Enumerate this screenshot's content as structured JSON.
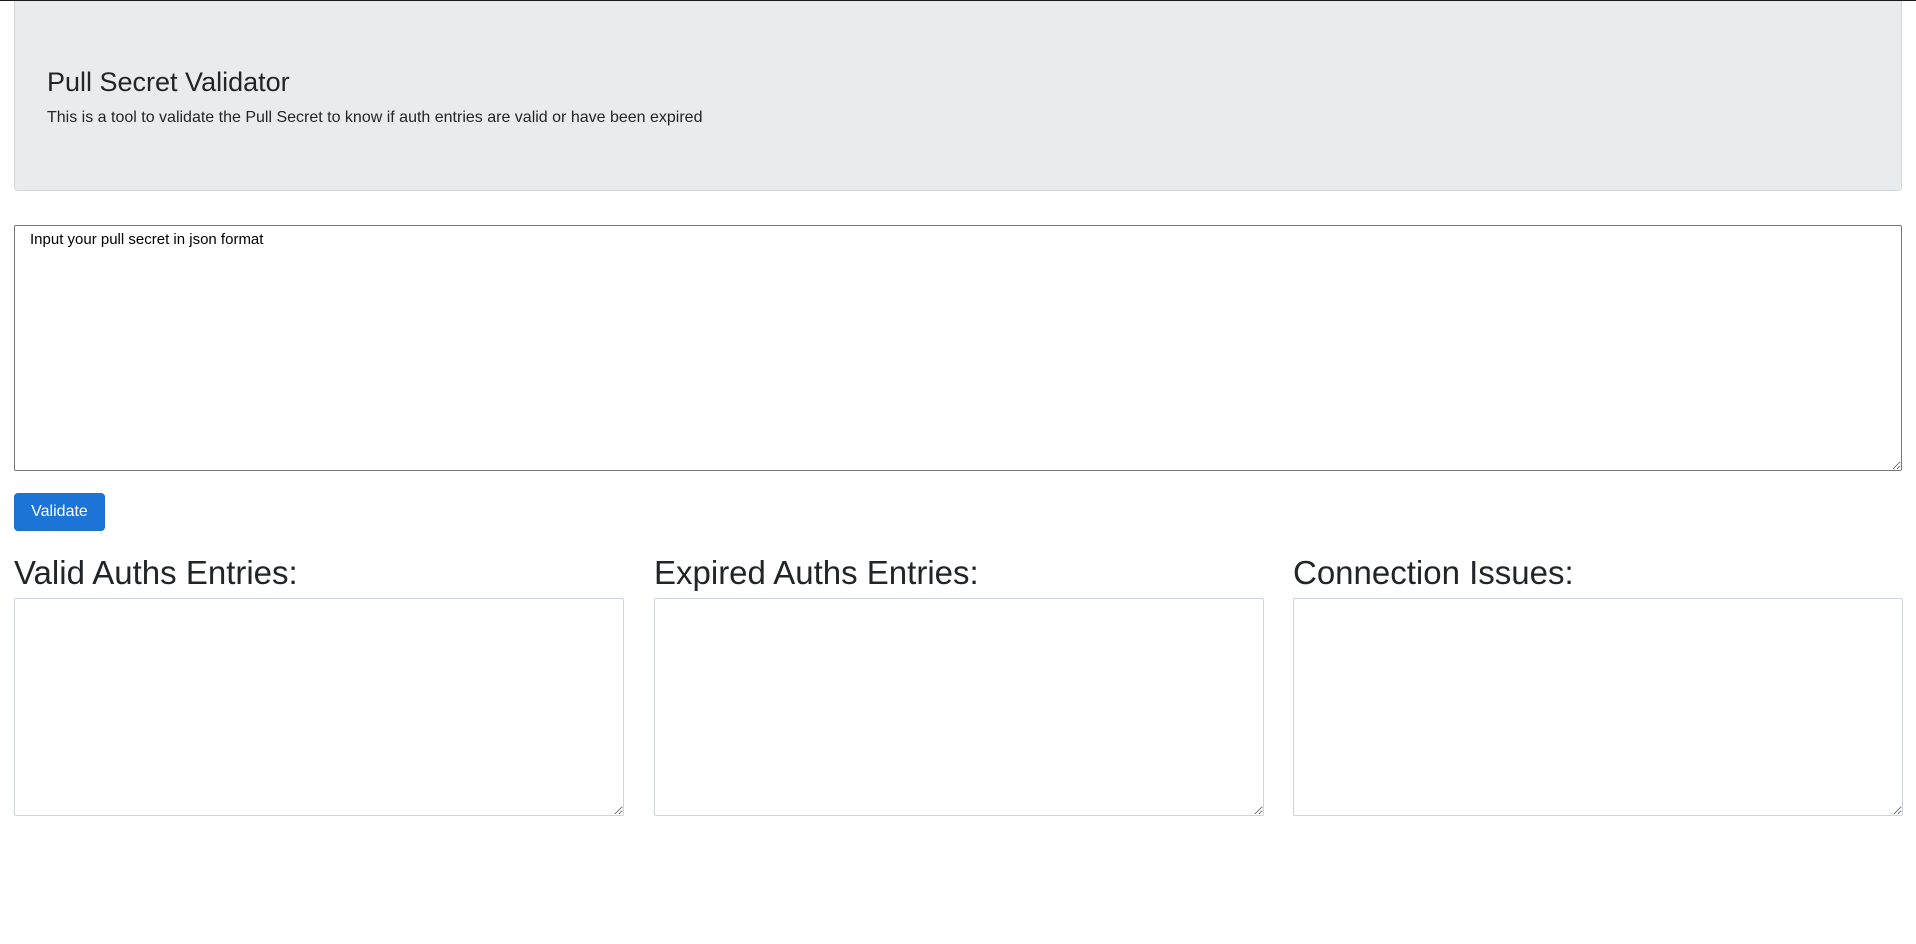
{
  "header": {
    "title": "Pull Secret Validator",
    "subtitle": "This is a tool to validate the Pull Secret to know if auth entries are valid or have been expired"
  },
  "input": {
    "placeholder": "Input your pull secret in json format",
    "value": ""
  },
  "actions": {
    "validate_label": "Validate"
  },
  "results": {
    "valid": {
      "heading": "Valid Auths Entries:",
      "value": ""
    },
    "expired": {
      "heading": "Expired Auths Entries:",
      "value": ""
    },
    "connection": {
      "heading": "Connection Issues:",
      "value": ""
    }
  },
  "colors": {
    "jumbotron_bg": "#e9ecef",
    "button_bg": "#1b74d6",
    "text": "#212529"
  }
}
